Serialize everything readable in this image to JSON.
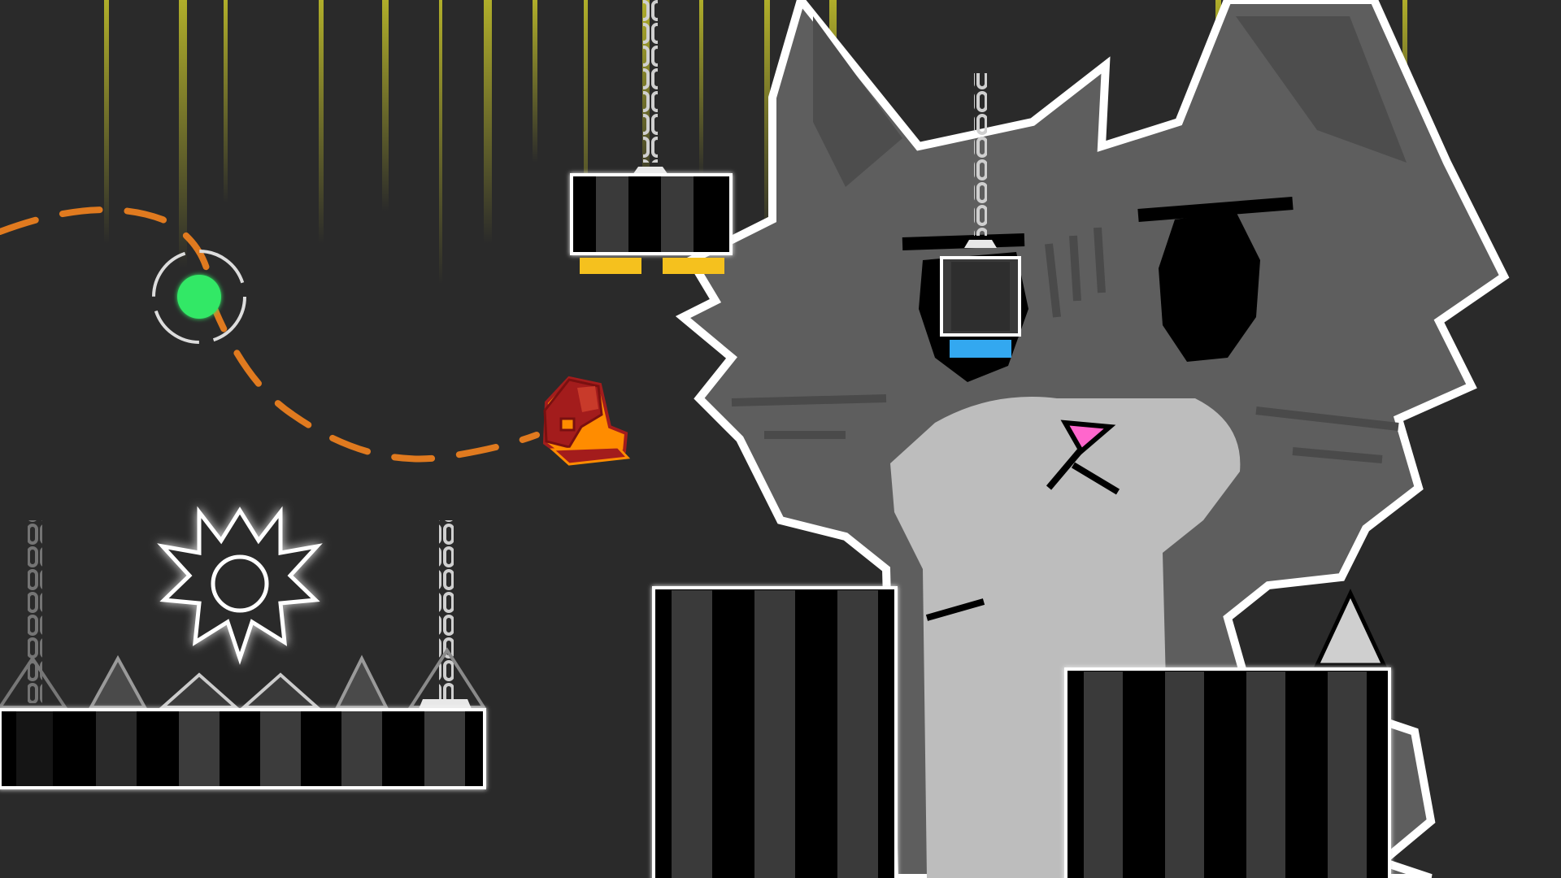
{
  "level": {
    "background_color": "#2a2a2a",
    "light_ray_color": "#b7b52a",
    "outline_color": "#ffffff",
    "ui_text": []
  },
  "player": {
    "mode": "ship",
    "primary_color": "#a31c1c",
    "secondary_color": "#ff8c00",
    "icon": "ship-icon"
  },
  "jump_orb": {
    "color": "#33e866",
    "icon": "green-orb-icon"
  },
  "trajectory": {
    "color": "#e07a1f",
    "style": "dashed"
  },
  "pads": {
    "yellow": "#f5c11e",
    "blue": "#33a8f0"
  },
  "cat": {
    "fur_color": "#5e5e5e",
    "muzzle_color": "#bdbdbd",
    "nose_color": "#ff66cc",
    "icon": "cat-background-art"
  },
  "hazards": [
    "spike-icon",
    "saw-blade-icon"
  ]
}
